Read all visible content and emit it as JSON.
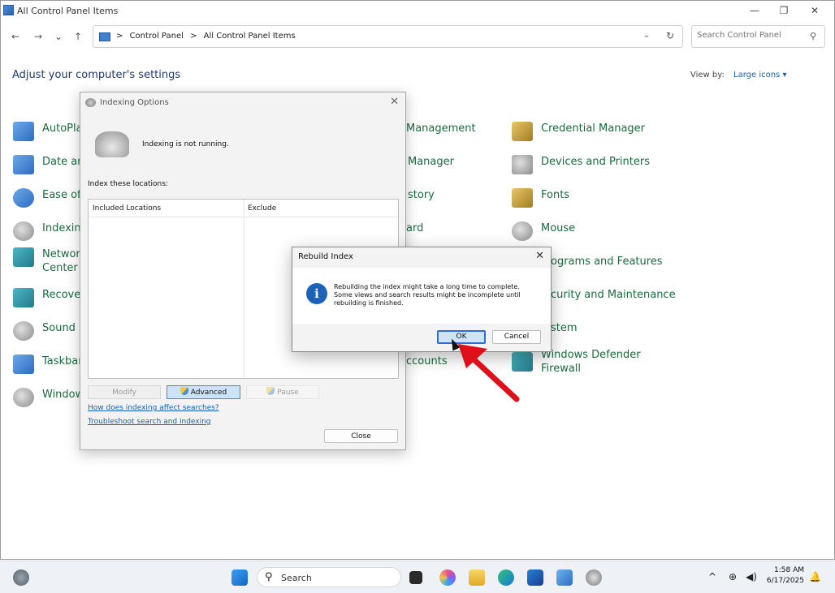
{
  "window": {
    "title": "All Control Panel Items",
    "minimize": "—",
    "maximize": "❐",
    "close": "✕"
  },
  "address": {
    "crumbs": [
      "Control Panel",
      "All Control Panel Items"
    ],
    "separator": ">",
    "search_placeholder": "Search Control Panel"
  },
  "page": {
    "heading": "Adjust your computer's settings",
    "view_by_label": "View by:",
    "view_by_value": "Large icons ▾"
  },
  "cp_items_left": [
    {
      "label": "AutoPlay"
    },
    {
      "label": "Date and"
    },
    {
      "label": "Ease of A"
    },
    {
      "label": "Indexing"
    },
    {
      "label": "Network",
      "label2": "Center"
    },
    {
      "label": "Recovery"
    },
    {
      "label": "Sound"
    },
    {
      "label": "Taskbar a"
    },
    {
      "label": "Windows"
    }
  ],
  "cp_items_mid": [
    {
      "label": "Management"
    },
    {
      "label": "Manager"
    },
    {
      "label": "story"
    },
    {
      "label": "ard"
    },
    {
      "label": "ccounts"
    }
  ],
  "cp_items_right": [
    {
      "label": "Credential Manager"
    },
    {
      "label": "Devices and Printers"
    },
    {
      "label": "Fonts"
    },
    {
      "label": "Mouse"
    },
    {
      "label": "ograms and Features"
    },
    {
      "label": "curity and Maintenance"
    },
    {
      "label": "stem"
    },
    {
      "label": "Windows Defender",
      "label2": "Firewall"
    }
  ],
  "indexing_dialog": {
    "title": "Indexing Options",
    "status": "Indexing is not running.",
    "locations_label": "Index these locations:",
    "col_included": "Included Locations",
    "col_exclude": "Exclude",
    "modify": "Modify",
    "advanced": "Advanced",
    "pause": "Pause",
    "link_affect": "How does indexing affect searches?",
    "link_troubleshoot": "Troubleshoot search and indexing",
    "close": "Close"
  },
  "rebuild_dialog": {
    "title": "Rebuild Index",
    "message_1": "Rebuilding the index might take a long time to complete.",
    "message_2": "Some views and search results might be incomplete until",
    "message_3": "rebuilding is finished.",
    "ok": "OK",
    "cancel": "Cancel"
  },
  "taskbar": {
    "search_label": "Search",
    "time": "1:58 AM",
    "date": "6/17/2025"
  },
  "colors": {
    "link_green": "#1a6b3c",
    "accent_blue": "#2a6fd0",
    "annotation_red": "#e0101a"
  }
}
